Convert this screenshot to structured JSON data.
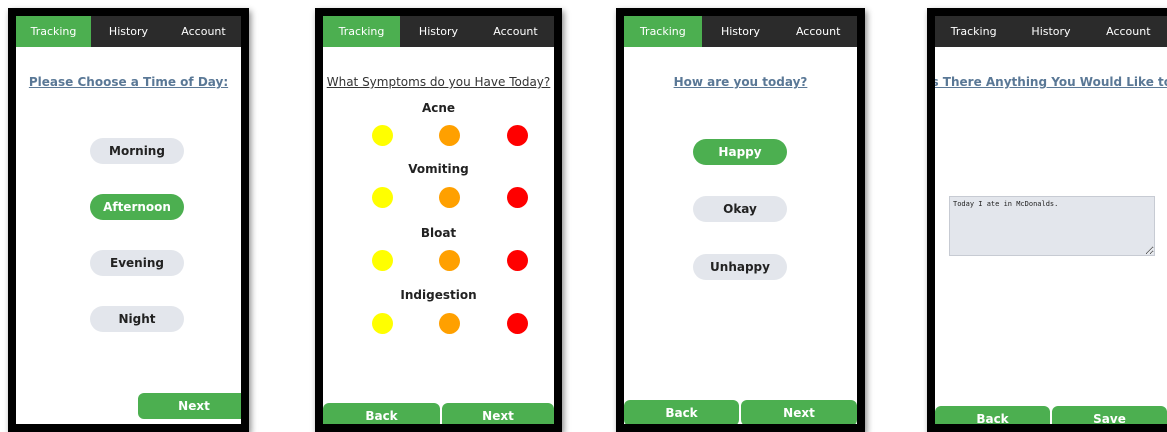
{
  "nav": {
    "tracking": "Tracking",
    "history": "History",
    "account": "Account"
  },
  "colors": {
    "accent": "#4caf50",
    "pill": "#e3e6ec",
    "nav": "#2b2b2b",
    "mild": "#ffff00",
    "moderate": "#ffa000",
    "severe": "#ff0000"
  },
  "screen1": {
    "title": "Please Choose a Time of Day:",
    "options": [
      "Morning",
      "Afternoon",
      "Evening",
      "Night"
    ],
    "selected": "Afternoon",
    "next": "Next"
  },
  "screen2": {
    "title": "What Symptoms do you Have Today?",
    "symptoms": [
      "Acne",
      "Vomiting",
      "Bloat",
      "Indigestion"
    ],
    "back": "Back",
    "next": "Next"
  },
  "screen3": {
    "title": "How are you today?",
    "options": [
      "Happy",
      "Okay",
      "Unhappy"
    ],
    "selected": "Happy",
    "back": "Back",
    "next": "Next"
  },
  "screen4": {
    "title": "Is There Anything You Would Like to Add?",
    "note": "Today I ate in McDonalds.",
    "back": "Back",
    "save": "Save"
  }
}
